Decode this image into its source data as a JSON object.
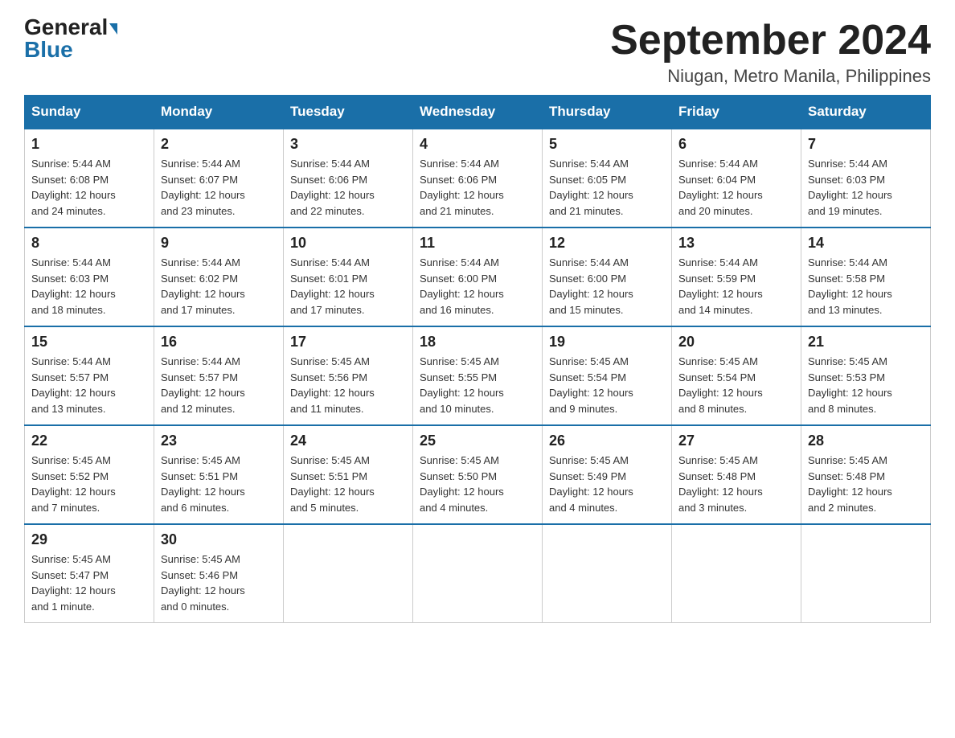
{
  "header": {
    "logo_general": "General",
    "logo_blue": "Blue",
    "month_title": "September 2024",
    "location": "Niugan, Metro Manila, Philippines"
  },
  "weekdays": [
    "Sunday",
    "Monday",
    "Tuesday",
    "Wednesday",
    "Thursday",
    "Friday",
    "Saturday"
  ],
  "weeks": [
    [
      {
        "day": "1",
        "sunrise": "5:44 AM",
        "sunset": "6:08 PM",
        "daylight": "12 hours and 24 minutes."
      },
      {
        "day": "2",
        "sunrise": "5:44 AM",
        "sunset": "6:07 PM",
        "daylight": "12 hours and 23 minutes."
      },
      {
        "day": "3",
        "sunrise": "5:44 AM",
        "sunset": "6:06 PM",
        "daylight": "12 hours and 22 minutes."
      },
      {
        "day": "4",
        "sunrise": "5:44 AM",
        "sunset": "6:06 PM",
        "daylight": "12 hours and 21 minutes."
      },
      {
        "day": "5",
        "sunrise": "5:44 AM",
        "sunset": "6:05 PM",
        "daylight": "12 hours and 21 minutes."
      },
      {
        "day": "6",
        "sunrise": "5:44 AM",
        "sunset": "6:04 PM",
        "daylight": "12 hours and 20 minutes."
      },
      {
        "day": "7",
        "sunrise": "5:44 AM",
        "sunset": "6:03 PM",
        "daylight": "12 hours and 19 minutes."
      }
    ],
    [
      {
        "day": "8",
        "sunrise": "5:44 AM",
        "sunset": "6:03 PM",
        "daylight": "12 hours and 18 minutes."
      },
      {
        "day": "9",
        "sunrise": "5:44 AM",
        "sunset": "6:02 PM",
        "daylight": "12 hours and 17 minutes."
      },
      {
        "day": "10",
        "sunrise": "5:44 AM",
        "sunset": "6:01 PM",
        "daylight": "12 hours and 17 minutes."
      },
      {
        "day": "11",
        "sunrise": "5:44 AM",
        "sunset": "6:00 PM",
        "daylight": "12 hours and 16 minutes."
      },
      {
        "day": "12",
        "sunrise": "5:44 AM",
        "sunset": "6:00 PM",
        "daylight": "12 hours and 15 minutes."
      },
      {
        "day": "13",
        "sunrise": "5:44 AM",
        "sunset": "5:59 PM",
        "daylight": "12 hours and 14 minutes."
      },
      {
        "day": "14",
        "sunrise": "5:44 AM",
        "sunset": "5:58 PM",
        "daylight": "12 hours and 13 minutes."
      }
    ],
    [
      {
        "day": "15",
        "sunrise": "5:44 AM",
        "sunset": "5:57 PM",
        "daylight": "12 hours and 13 minutes."
      },
      {
        "day": "16",
        "sunrise": "5:44 AM",
        "sunset": "5:57 PM",
        "daylight": "12 hours and 12 minutes."
      },
      {
        "day": "17",
        "sunrise": "5:45 AM",
        "sunset": "5:56 PM",
        "daylight": "12 hours and 11 minutes."
      },
      {
        "day": "18",
        "sunrise": "5:45 AM",
        "sunset": "5:55 PM",
        "daylight": "12 hours and 10 minutes."
      },
      {
        "day": "19",
        "sunrise": "5:45 AM",
        "sunset": "5:54 PM",
        "daylight": "12 hours and 9 minutes."
      },
      {
        "day": "20",
        "sunrise": "5:45 AM",
        "sunset": "5:54 PM",
        "daylight": "12 hours and 8 minutes."
      },
      {
        "day": "21",
        "sunrise": "5:45 AM",
        "sunset": "5:53 PM",
        "daylight": "12 hours and 8 minutes."
      }
    ],
    [
      {
        "day": "22",
        "sunrise": "5:45 AM",
        "sunset": "5:52 PM",
        "daylight": "12 hours and 7 minutes."
      },
      {
        "day": "23",
        "sunrise": "5:45 AM",
        "sunset": "5:51 PM",
        "daylight": "12 hours and 6 minutes."
      },
      {
        "day": "24",
        "sunrise": "5:45 AM",
        "sunset": "5:51 PM",
        "daylight": "12 hours and 5 minutes."
      },
      {
        "day": "25",
        "sunrise": "5:45 AM",
        "sunset": "5:50 PM",
        "daylight": "12 hours and 4 minutes."
      },
      {
        "day": "26",
        "sunrise": "5:45 AM",
        "sunset": "5:49 PM",
        "daylight": "12 hours and 4 minutes."
      },
      {
        "day": "27",
        "sunrise": "5:45 AM",
        "sunset": "5:48 PM",
        "daylight": "12 hours and 3 minutes."
      },
      {
        "day": "28",
        "sunrise": "5:45 AM",
        "sunset": "5:48 PM",
        "daylight": "12 hours and 2 minutes."
      }
    ],
    [
      {
        "day": "29",
        "sunrise": "5:45 AM",
        "sunset": "5:47 PM",
        "daylight": "12 hours and 1 minute."
      },
      {
        "day": "30",
        "sunrise": "5:45 AM",
        "sunset": "5:46 PM",
        "daylight": "12 hours and 0 minutes."
      },
      null,
      null,
      null,
      null,
      null
    ]
  ],
  "labels": {
    "sunrise": "Sunrise:",
    "sunset": "Sunset:",
    "daylight": "Daylight:"
  }
}
